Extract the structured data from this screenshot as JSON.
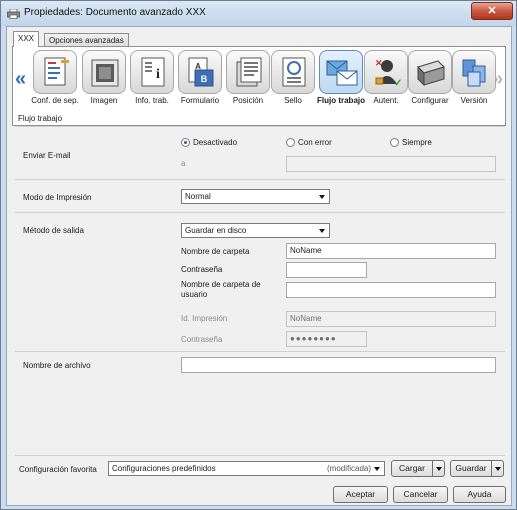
{
  "window": {
    "title": "Propiedades: Documento avanzado XXX",
    "close_label": "✕"
  },
  "tabs": [
    {
      "label": "XXX",
      "active": true
    },
    {
      "label": "Opciones avanzadas",
      "active": false
    }
  ],
  "ribbon": {
    "left_arrow": "«",
    "right_arrow": "»",
    "items": [
      {
        "label": "Conf. de sep.",
        "icon": "separator-settings-icon"
      },
      {
        "label": "Imagen",
        "icon": "image-icon"
      },
      {
        "label": "Info. trab.",
        "icon": "job-info-icon"
      },
      {
        "label": "Formulario",
        "icon": "form-icon"
      },
      {
        "label": "Posición",
        "icon": "position-icon"
      },
      {
        "label": "Sello",
        "icon": "stamp-icon"
      },
      {
        "label": "Flujo trabajo",
        "icon": "workflow-icon",
        "selected": true
      },
      {
        "label": "Autent.",
        "icon": "authentication-icon"
      },
      {
        "label": "Configurar",
        "icon": "configure-icon"
      },
      {
        "label": "Versión",
        "icon": "version-icon"
      }
    ]
  },
  "panel": {
    "title": "Flujo trabajo",
    "email": {
      "label": "Enviar E-mail",
      "options": [
        {
          "label": "Desactivado",
          "selected": true
        },
        {
          "label": "Con error",
          "selected": false
        },
        {
          "label": "Siempre",
          "selected": false
        }
      ],
      "to_label": "a",
      "to_value": ""
    },
    "print_mode": {
      "label": "Modo de Impresión",
      "value": "Normal"
    },
    "output": {
      "label": "Método de salida",
      "value": "Guardar en disco",
      "folder_name_label": "Nombre de carpeta",
      "folder_name_value": "NoName",
      "password_label": "Contraseña",
      "password_value": "",
      "user_folder_label": "Nombre de carpeta de usuario",
      "user_folder_value": "",
      "print_id_label": "Id. Impresión",
      "print_id_value": "NoName",
      "print_password_label": "Contraseña",
      "print_password_value": "●●●●●●●●"
    },
    "file_name": {
      "label": "Nombre de archivo",
      "value": ""
    }
  },
  "favorites": {
    "label": "Configuración favorita",
    "value": "Configuraciones predefinidos",
    "status": "(modificada)",
    "load_label": "Cargar",
    "save_label": "Guardar"
  },
  "footer": {
    "ok_label": "Aceptar",
    "cancel_label": "Cancelar",
    "help_label": "Ayuda"
  },
  "colors": {
    "title_bar": "#c2d5ea",
    "close_button": "#c75842",
    "selected_tab": "#bcd8f3"
  }
}
